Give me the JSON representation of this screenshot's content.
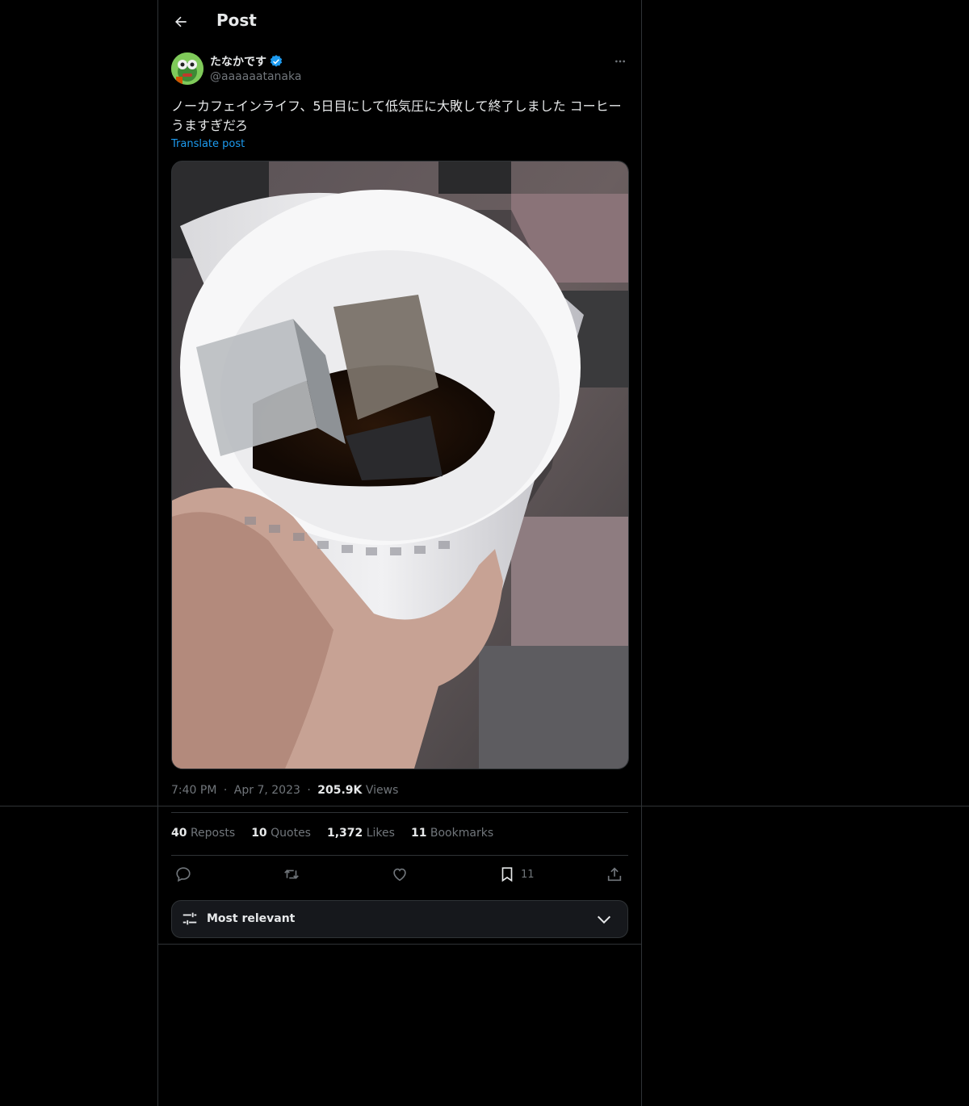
{
  "header": {
    "title": "Post"
  },
  "author": {
    "name": "たなかです",
    "handle": "@aaaaaatanaka"
  },
  "post": {
    "text": "ノーカフェインライフ、5日目にして低気圧に大敗して終了しました コーヒーうますぎだろ",
    "translate_label": "Translate post"
  },
  "meta": {
    "time": "7:40 PM",
    "date": "Apr 7, 2023",
    "views_count": "205.9K",
    "views_label": "Views",
    "separator": "·"
  },
  "stats": {
    "reposts_count": "40",
    "reposts_label": "Reposts",
    "quotes_count": "10",
    "quotes_label": "Quotes",
    "likes_count": "1,372",
    "likes_label": "Likes",
    "bookmarks_count": "11",
    "bookmarks_label": "Bookmarks"
  },
  "actions": {
    "bookmark_count": "11"
  },
  "sort": {
    "label": "Most relevant"
  },
  "colors": {
    "background": "#000000",
    "accent": "#1d9bf0",
    "border": "#2f3336",
    "muted": "#71767b"
  }
}
